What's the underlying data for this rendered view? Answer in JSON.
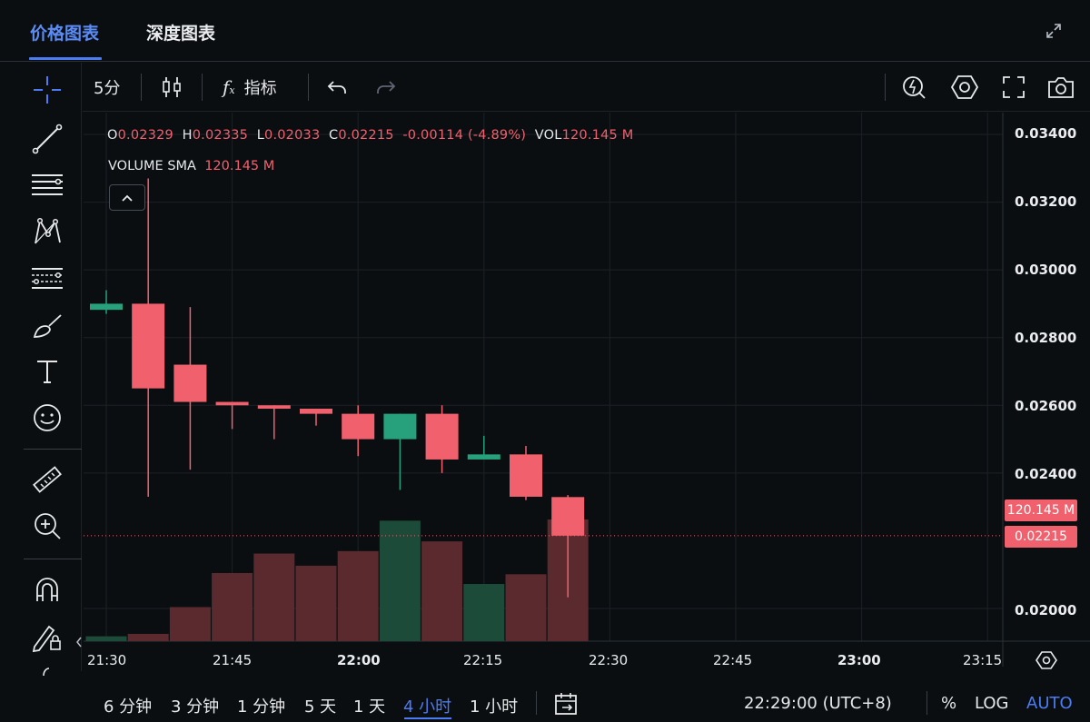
{
  "tabs": [
    {
      "label": "价格图表",
      "active": true
    },
    {
      "label": "深度图表",
      "active": false
    }
  ],
  "toolbar": {
    "interval": "5分",
    "indicator_label": "指标"
  },
  "legend": {
    "o_label": "O",
    "o_value": "0.02329",
    "h_label": "H",
    "h_value": "0.02335",
    "l_label": "L",
    "l_value": "0.02033",
    "c_label": "C",
    "c_value": "0.02215",
    "change": "-0.00114",
    "change_pct": "(-4.89%)",
    "vol_label": "VOL",
    "vol_value": "120.145 M",
    "sma_label": "VOLUME SMA",
    "sma_value": "120.145 M"
  },
  "price_axis": [
    "0.03400",
    "0.03200",
    "0.03000",
    "0.02800",
    "0.02600",
    "0.02400",
    "0.02000"
  ],
  "price_tags": {
    "volume": "120.145 M",
    "last": "0.02215"
  },
  "time_axis": [
    {
      "label": "21:30",
      "bold": false
    },
    {
      "label": "21:45",
      "bold": false
    },
    {
      "label": "22:00",
      "bold": true
    },
    {
      "label": "22:15",
      "bold": false
    },
    {
      "label": "22:30",
      "bold": false
    },
    {
      "label": "22:45",
      "bold": false
    },
    {
      "label": "23:00",
      "bold": true
    },
    {
      "label": "23:15",
      "bold": false
    }
  ],
  "bottom_bar": {
    "intervals": [
      "6 分钟",
      "3 分钟",
      "1 分钟",
      "5 天",
      "1 天",
      "4 小时",
      "1 小时"
    ],
    "active_interval": "4 小时",
    "clock": "22:29:00 (UTC+8)",
    "percent": "%",
    "log": "LOG",
    "auto": "AUTO"
  },
  "colors": {
    "up": "#26a17b",
    "down": "#f0616d",
    "vol_up": "#1d4b3a",
    "vol_down": "#5b2a2e",
    "accent": "#4c7cf3"
  },
  "chart_data": {
    "type": "candlestick",
    "interval": "5分",
    "times": [
      "21:30",
      "21:35",
      "21:40",
      "21:45",
      "21:50",
      "21:55",
      "22:00",
      "22:05",
      "22:10",
      "22:15",
      "22:20",
      "22:25"
    ],
    "candles": [
      {
        "o": 0.02882,
        "h": 0.0294,
        "l": 0.0287,
        "c": 0.029
      },
      {
        "o": 0.029,
        "h": 0.0327,
        "l": 0.0233,
        "c": 0.0265
      },
      {
        "o": 0.0272,
        "h": 0.0289,
        "l": 0.0241,
        "c": 0.0261
      },
      {
        "o": 0.0261,
        "h": 0.0261,
        "l": 0.0253,
        "c": 0.026
      },
      {
        "o": 0.026,
        "h": 0.026,
        "l": 0.025,
        "c": 0.0259
      },
      {
        "o": 0.0259,
        "h": 0.0259,
        "l": 0.0254,
        "c": 0.02575
      },
      {
        "o": 0.02575,
        "h": 0.026,
        "l": 0.0245,
        "c": 0.025
      },
      {
        "o": 0.025,
        "h": 0.02575,
        "l": 0.0235,
        "c": 0.02575
      },
      {
        "o": 0.02575,
        "h": 0.026,
        "l": 0.024,
        "c": 0.0244
      },
      {
        "o": 0.0244,
        "h": 0.0251,
        "l": 0.0244,
        "c": 0.02455
      },
      {
        "o": 0.02455,
        "h": 0.0248,
        "l": 0.0232,
        "c": 0.0233
      },
      {
        "o": 0.02329,
        "h": 0.02335,
        "l": 0.02033,
        "c": 0.02215
      }
    ],
    "volume_direction": [
      "up",
      "down",
      "down",
      "down",
      "down",
      "down",
      "down",
      "up",
      "down",
      "up",
      "down",
      "down"
    ],
    "volume_relative": [
      0.04,
      0.06,
      0.28,
      0.56,
      0.72,
      0.62,
      0.74,
      0.99,
      0.82,
      0.47,
      0.55,
      1.0
    ],
    "ylim": [
      0.0197,
      0.0345
    ],
    "y_ticks": [
      0.034,
      0.032,
      0.03,
      0.028,
      0.026,
      0.024,
      0.02
    ],
    "last_price": 0.02215,
    "grid": true
  }
}
